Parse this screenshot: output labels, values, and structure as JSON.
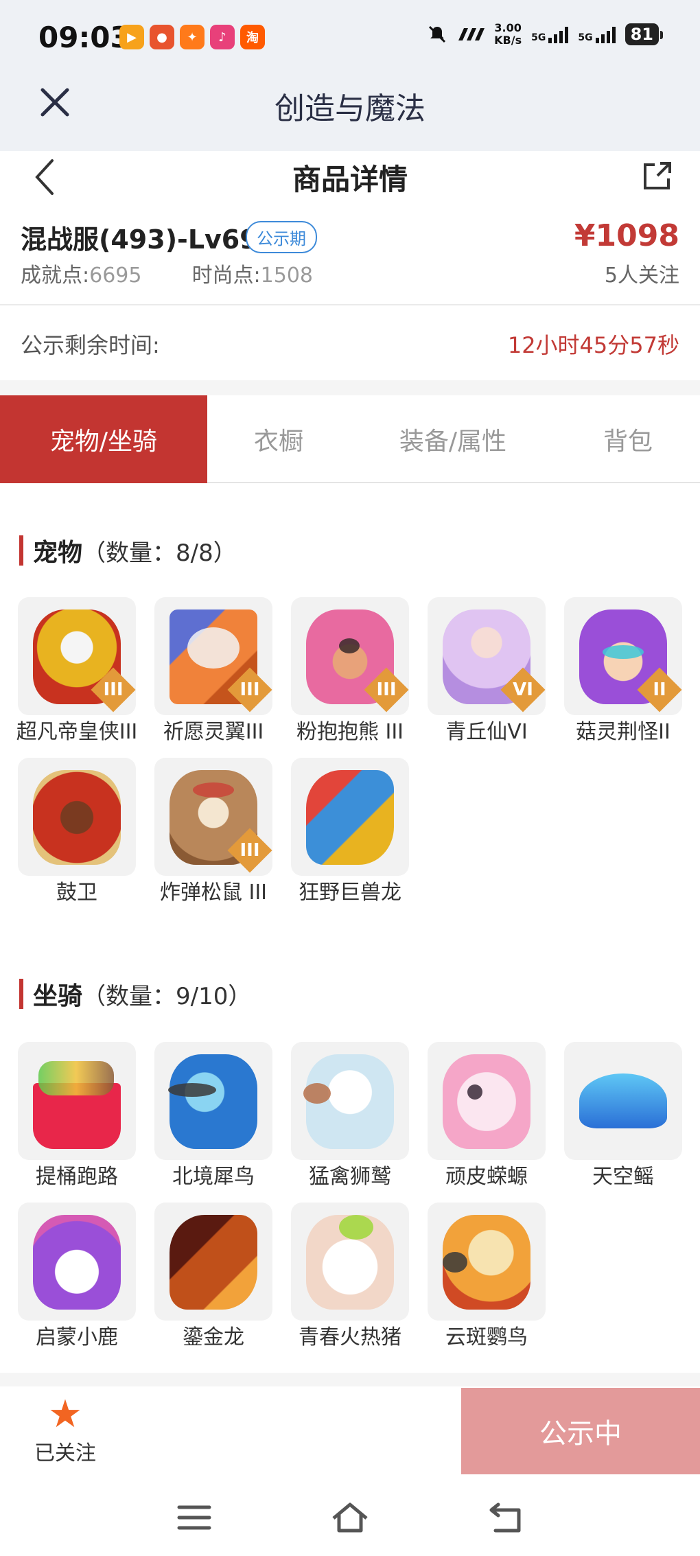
{
  "status_bar": {
    "time": "09:03",
    "speed_value": "3.00",
    "speed_unit": "KB/s",
    "net1": "5G",
    "net2": "5G",
    "battery": "81"
  },
  "app_header": {
    "title": "创造与魔法"
  },
  "page_header": {
    "title": "商品详情"
  },
  "product": {
    "server": "混战服(493)-Lv69",
    "badge": "公示期",
    "price": "¥1098",
    "followers": "5人关注",
    "achievement_label": "成就点:",
    "achievement_value": "6695",
    "fashion_label": "时尚点:",
    "fashion_value": "1508"
  },
  "countdown": {
    "label": "公示剩余时间:",
    "value": "12小时45分57秒"
  },
  "tabs": [
    {
      "label": "宠物/坐骑",
      "active": true
    },
    {
      "label": "衣橱",
      "active": false
    },
    {
      "label": "装备/属性",
      "active": false
    },
    {
      "label": "背包",
      "active": false
    }
  ],
  "pets": {
    "title": "宠物",
    "count": "（数量：8/8）",
    "items": [
      {
        "name": "超凡帝皇侠III",
        "tier": "III"
      },
      {
        "name": "祈愿灵翼III",
        "tier": "III"
      },
      {
        "name": "粉抱抱熊 III",
        "tier": "III"
      },
      {
        "name": "青丘仙VI",
        "tier": "VI"
      },
      {
        "name": "菇灵荆怪II",
        "tier": "II"
      },
      {
        "name": "鼓卫",
        "tier": ""
      },
      {
        "name": "炸弹松鼠 III",
        "tier": "III"
      },
      {
        "name": "狂野巨兽龙",
        "tier": ""
      }
    ]
  },
  "mounts": {
    "title": "坐骑",
    "count": "（数量：9/10）",
    "items": [
      {
        "name": "提桶跑路"
      },
      {
        "name": "北境犀鸟"
      },
      {
        "name": "猛禽狮鹫"
      },
      {
        "name": "顽皮蝾螈"
      },
      {
        "name": "天空鳐"
      },
      {
        "name": "启蒙小鹿"
      },
      {
        "name": "鎏金龙"
      },
      {
        "name": "青春火热猪"
      },
      {
        "name": "云斑鹦鸟"
      }
    ]
  },
  "bottom": {
    "follow_label": "已关注",
    "status_label": "公示中"
  },
  "colors": {
    "accent": "#c33531",
    "price": "#c23a36",
    "badge": "#3d8ad9",
    "star": "#f26522",
    "status_button": "#e39a9a"
  },
  "icons": [
    "close-icon",
    "back-icon",
    "share-icon",
    "star-icon",
    "menu-icon",
    "home-icon",
    "return-icon"
  ]
}
